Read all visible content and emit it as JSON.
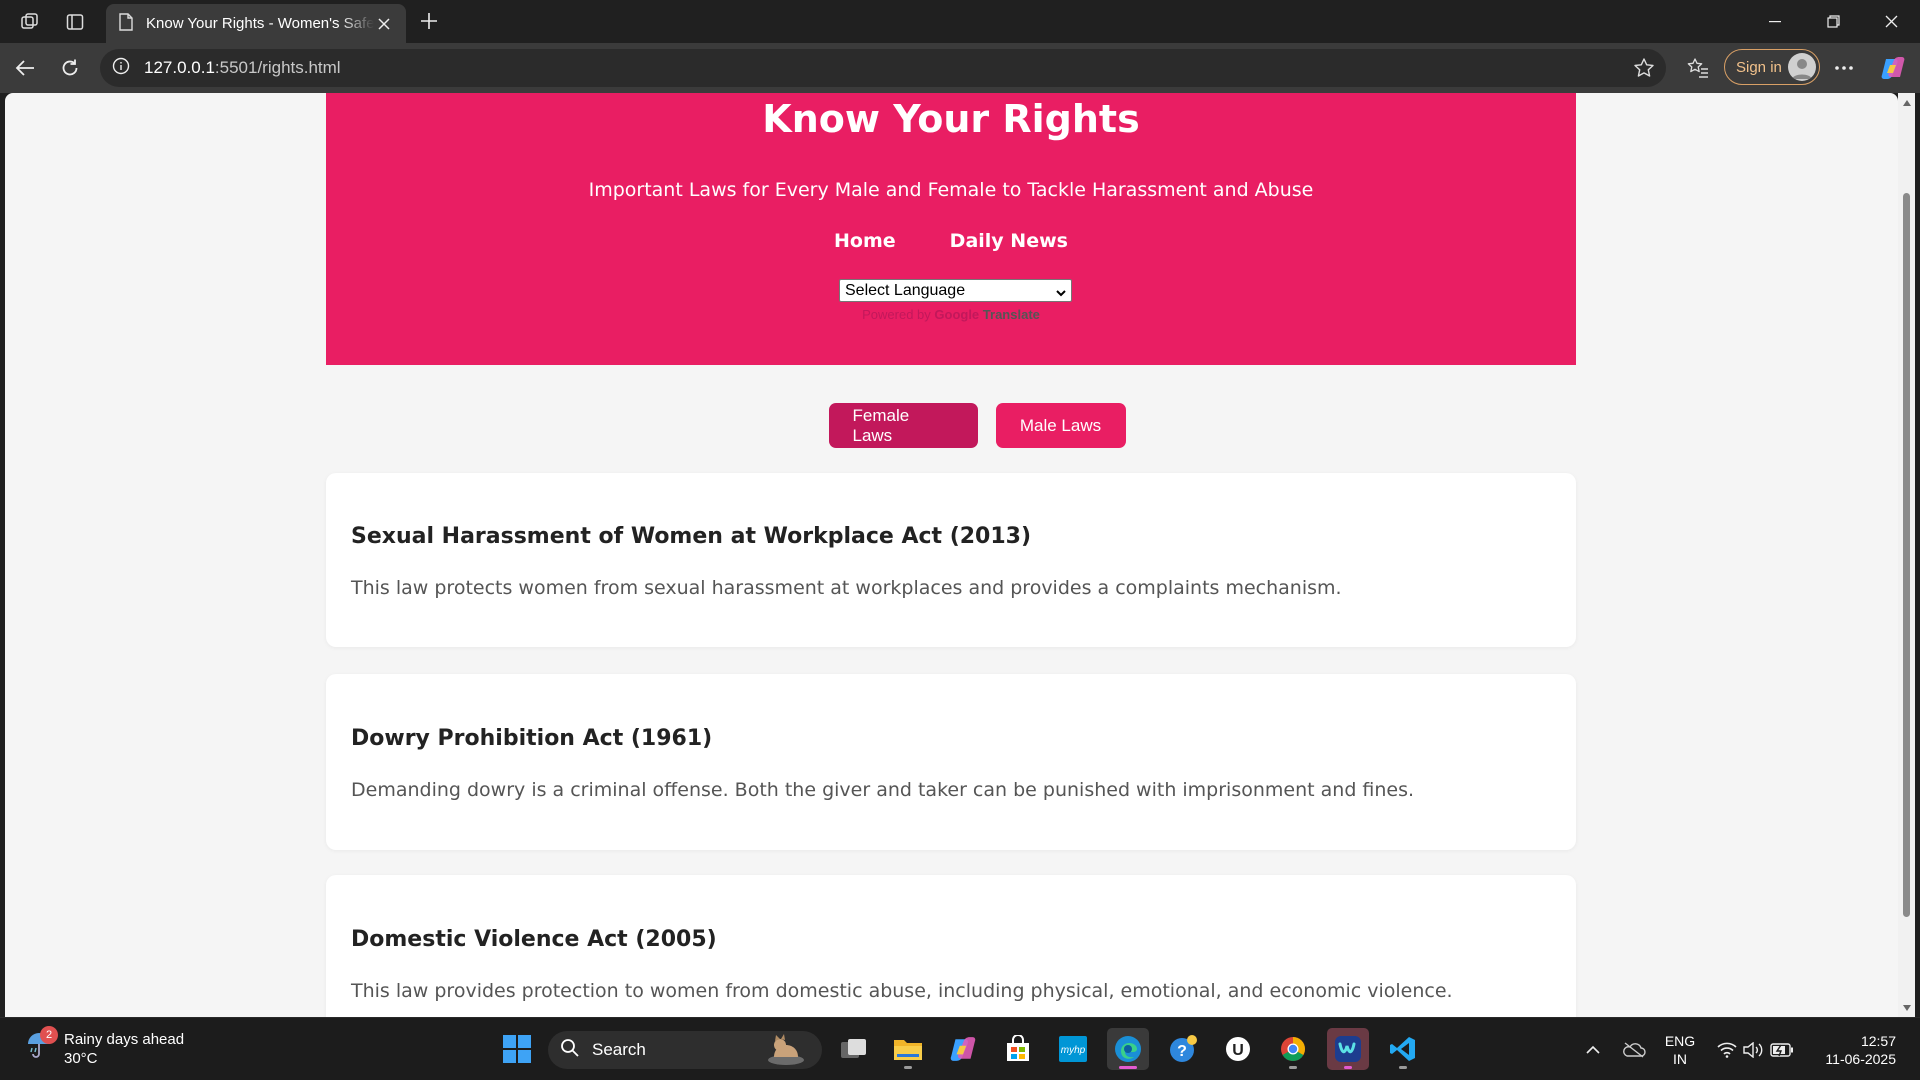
{
  "browser": {
    "tab_title": "Know Your Rights - Women's Safety",
    "url_host": "127.0.0.1",
    "url_path": ":5501/rights.html",
    "signin_label": "Sign in"
  },
  "hero": {
    "title": "Know Your Rights",
    "subtitle": "Important Laws for Every Male and Female to Tackle Harassment and Abuse",
    "nav": [
      "Home",
      "Daily News"
    ],
    "language_select": "Select Language",
    "powered_by": "Powered by",
    "google": "Google",
    "translate": "Translate"
  },
  "law_tabs": {
    "female": "Female Laws",
    "male": "Male Laws",
    "active": "female"
  },
  "laws": [
    {
      "title": "Sexual Harassment of Women at Workplace Act (2013)",
      "description": "This law protects women from sexual harassment at workplaces and provides a complaints mechanism."
    },
    {
      "title": "Dowry Prohibition Act (1961)",
      "description": "Demanding dowry is a criminal offense. Both the giver and taker can be punished with imprisonment and fines."
    },
    {
      "title": "Domestic Violence Act (2005)",
      "description": "This law provides protection to women from domestic abuse, including physical, emotional, and economic violence."
    }
  ],
  "taskbar": {
    "weather_title": "Rainy days ahead",
    "weather_temp": "30°C",
    "weather_badge": "2",
    "search_label": "Search",
    "lang_top": "ENG",
    "lang_bottom": "IN",
    "time": "12:57",
    "date": "11-06-2025"
  },
  "colors": {
    "brand": "#e91e63",
    "brand_dark": "#c2185b",
    "page_bg": "#f5f5f5"
  }
}
